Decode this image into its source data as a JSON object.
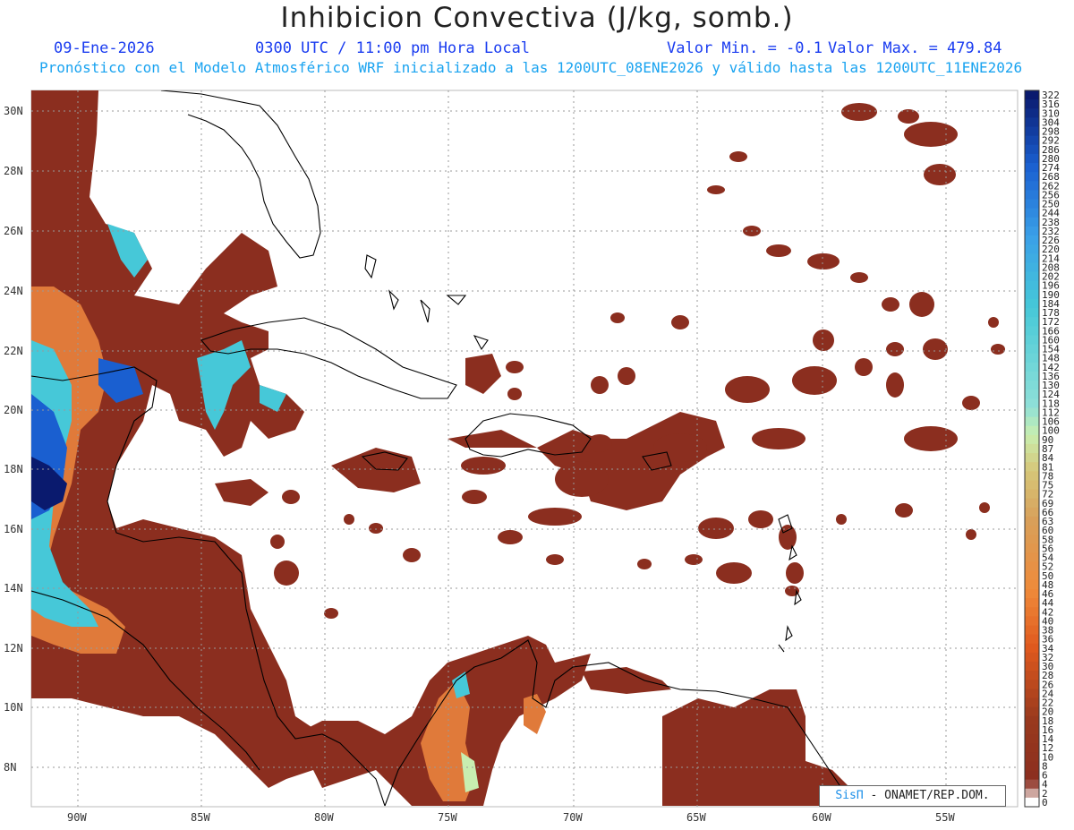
{
  "header": {
    "title": "Inhibicion Convectiva (J/kg, somb.)",
    "date": "09-Ene-2026",
    "time": "0300 UTC / 11:00 pm Hora Local",
    "min_label": "Valor Min. = -0.1",
    "max_label": "Valor Max. = 479.84",
    "subtitle": "Pronóstico con el Modelo Atmosférico WRF inicializado a las 1200UTC_08ENE2026 y válido hasta las  1200UTC_11ENE2026"
  },
  "map": {
    "lon_ticks": [
      "90W",
      "85W",
      "80W",
      "75W",
      "70W",
      "65W",
      "60W",
      "55W"
    ],
    "lat_ticks": [
      "30N",
      "28N",
      "26N",
      "24N",
      "22N",
      "20N",
      "18N",
      "16N",
      "14N",
      "12N",
      "10N",
      "8N"
    ]
  },
  "colorbar": {
    "labels": [
      "322",
      "316",
      "310",
      "304",
      "298",
      "292",
      "286",
      "280",
      "274",
      "268",
      "262",
      "256",
      "250",
      "244",
      "238",
      "232",
      "226",
      "220",
      "214",
      "208",
      "202",
      "196",
      "190",
      "184",
      "178",
      "172",
      "166",
      "160",
      "154",
      "148",
      "142",
      "136",
      "130",
      "124",
      "118",
      "112",
      "106",
      "100",
      "90",
      "87",
      "84",
      "81",
      "78",
      "75",
      "72",
      "69",
      "66",
      "63",
      "60",
      "58",
      "56",
      "54",
      "52",
      "50",
      "48",
      "46",
      "44",
      "42",
      "40",
      "38",
      "36",
      "34",
      "32",
      "30",
      "28",
      "26",
      "24",
      "22",
      "20",
      "18",
      "16",
      "14",
      "12",
      "10",
      "8",
      "6",
      "4",
      "2",
      "0"
    ]
  },
  "colors": {
    "low": "#8b2e1f",
    "mid": "#e05a1e",
    "yellow": "#d8cf7a",
    "green": "#c8eeb0",
    "cyan": "#46c8d8",
    "blue": "#1a5fd0",
    "navy": "#0a1a6e"
  },
  "credit": {
    "brand": "SisΠ",
    "text": "- ONAMET/REP.DOM."
  }
}
